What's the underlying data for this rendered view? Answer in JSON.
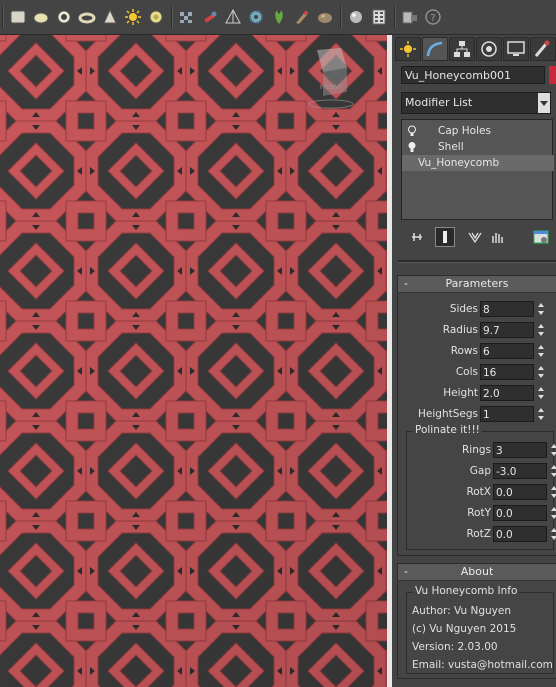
{
  "toolbar": {
    "buttons": [
      "box-icon",
      "sphere-icon",
      "cylinder-icon",
      "torus-icon",
      "cone-icon",
      "light-icon",
      "geosphere-icon",
      "checker-icon",
      "wrench-icon",
      "gizmo-icon",
      "gear-icon",
      "plant-icon",
      "brush-icon",
      "stone-icon",
      "material-ball-icon",
      "schematic-icon",
      "render-icon",
      "help-icon"
    ]
  },
  "viewport": {
    "label": "FRONT",
    "background": "#3a3a3a",
    "mesh_color": "#c8575b"
  },
  "panel": {
    "tabs": [
      "create-tab",
      "modify-tab",
      "hierarchy-tab",
      "motion-tab",
      "display-tab",
      "utilities-tab"
    ],
    "object_name": "Vu_Honeycomb001",
    "object_color": "#c8283a",
    "modifier_list_label": "Modifier List",
    "stack": [
      "Cap Holes",
      "Shell",
      "Vu_Honeycomb"
    ]
  },
  "parameters": {
    "title": "Parameters",
    "collapse": "-",
    "rows": [
      {
        "label": "Sides",
        "value": "8"
      },
      {
        "label": "Radius",
        "value": "9.7"
      },
      {
        "label": "Rows",
        "value": "6"
      },
      {
        "label": "Cols",
        "value": "16"
      },
      {
        "label": "Height",
        "value": "2.0"
      },
      {
        "label": "HeightSegs",
        "value": "1"
      }
    ],
    "polinate": {
      "title": "Polinate it!!!",
      "rows": [
        {
          "label": "Rings",
          "value": "3"
        },
        {
          "label": "Gap",
          "value": "-3.0"
        },
        {
          "label": "RotX",
          "value": "0.0"
        },
        {
          "label": "RotY",
          "value": "0.0"
        },
        {
          "label": "RotZ",
          "value": "0.0"
        }
      ]
    }
  },
  "about": {
    "title": "About",
    "collapse": "-",
    "group_title": "Vu Honeycomb Info",
    "lines": [
      "Author: Vu Nguyen",
      "(c) Vu Nguyen 2015",
      "Version: 2.03.00",
      "Email: vusta@hotmail.com"
    ]
  }
}
